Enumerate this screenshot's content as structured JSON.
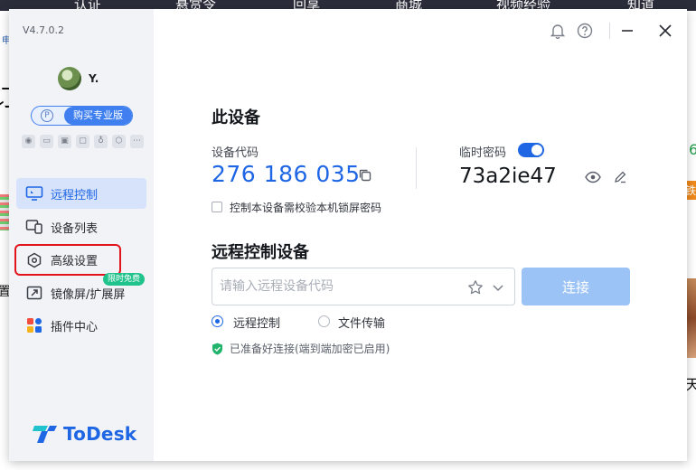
{
  "background": {
    "nav_items": [
      "认证",
      "悬赏令",
      "回享",
      "商城",
      "视频经验",
      "知道"
    ],
    "left_fragments": [
      "申",
      "订",
      "置"
    ],
    "right_fragments": [
      "6",
      "铁",
      "天"
    ]
  },
  "app": {
    "version": "V4.7.0.2",
    "user": {
      "name": "Y."
    },
    "pro_badge": {
      "icon": "P",
      "label": "购买专业版"
    },
    "quick_icons": [
      "game-icon",
      "monitor-icon",
      "window-icon",
      "chat-icon",
      "bulb-icon",
      "gear-icon",
      "more-icon"
    ],
    "nav": [
      {
        "label": "远程控制",
        "icon": "remote-screen-icon",
        "active": true
      },
      {
        "label": "设备列表",
        "icon": "devices-icon"
      },
      {
        "label": "高级设置",
        "icon": "hex-settings-icon",
        "highlighted": true
      },
      {
        "label": "镜像屏/扩展屏",
        "icon": "mirror-screen-icon",
        "tag": "限时免费"
      },
      {
        "label": "插件中心",
        "icon": "plugin-grid-icon"
      }
    ],
    "logo": {
      "text": "ToDesk"
    },
    "this_device": {
      "title": "此设备",
      "code_label": "设备代码",
      "code": "276 186 035",
      "temp_pass_label": "临时密码",
      "temp_pass": "73a2ie47",
      "lock_check_label": "控制本设备需校验本机锁屏密码"
    },
    "remote": {
      "title": "远程控制设备",
      "placeholder": "请输入远程设备代码",
      "connect_label": "连接",
      "modes": [
        "远程控制",
        "文件传输"
      ],
      "selected_mode": 0,
      "status": "已准备好连接(端到端加密已启用)"
    },
    "colors": {
      "accent": "#1f66e5",
      "sidebar_bg": "#f1f3f7",
      "highlight_border": "#e3131b",
      "free_tag": "#21c38d",
      "ok_green": "#21b36b"
    }
  }
}
